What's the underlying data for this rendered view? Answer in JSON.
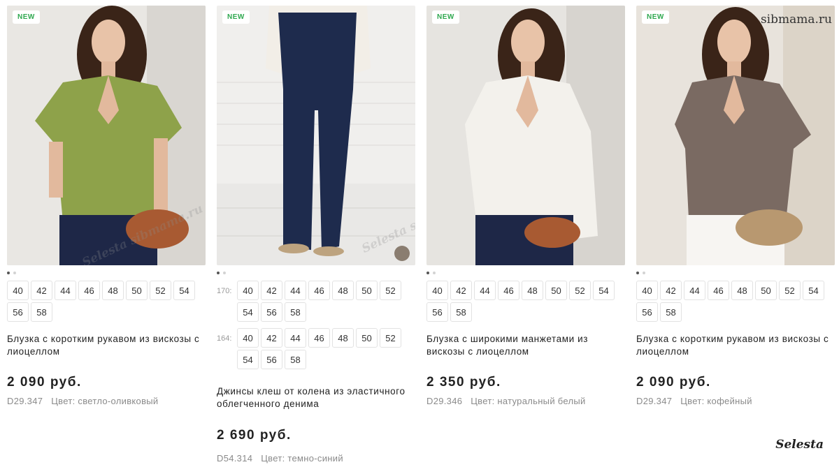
{
  "badge_new": "NEW",
  "products": [
    {
      "title": "Блузка с коротким рукавом из вискозы с лиоцеллом",
      "price": "2 090 руб.",
      "code": "D29.347",
      "color_label": "Цвет: светло-оливковый",
      "sizes": [
        "40",
        "42",
        "44",
        "46",
        "48",
        "50",
        "52",
        "54",
        "56",
        "58"
      ],
      "accent": "#8ea24a"
    },
    {
      "title": "Джинсы клеш от колена из эластичного облегченного денима",
      "price": "2 690 руб.",
      "code": "D54.314",
      "color_label": "Цвет: темно-синий",
      "height_rows": [
        {
          "label": "170:",
          "sizes": [
            "40",
            "42",
            "44",
            "46",
            "48",
            "50",
            "52",
            "54",
            "56",
            "58"
          ]
        },
        {
          "label": "164:",
          "sizes": [
            "40",
            "42",
            "44",
            "46",
            "48",
            "50",
            "52",
            "54",
            "56",
            "58"
          ]
        }
      ],
      "accent": "#1e2b4d"
    },
    {
      "title": "Блузка с широкими манжетами из вискозы с лиоцеллом",
      "price": "2 350 руб.",
      "code": "D29.346",
      "color_label": "Цвет: натуральный белый",
      "sizes": [
        "40",
        "42",
        "44",
        "46",
        "48",
        "50",
        "52",
        "54",
        "56",
        "58"
      ],
      "accent": "#f3f1ec"
    },
    {
      "title": "Блузка с коротким рукавом из вискозы с лиоцеллом",
      "price": "2 090 руб.",
      "code": "D29.347",
      "color_label": "Цвет: кофейный",
      "sizes": [
        "40",
        "42",
        "44",
        "46",
        "48",
        "50",
        "52",
        "54",
        "56",
        "58"
      ],
      "accent": "#7a6a62"
    }
  ],
  "watermark_site": "sibmama.ru",
  "watermark_brand": "Selesta",
  "watermark_diag": "Selesta sibmama.ru"
}
